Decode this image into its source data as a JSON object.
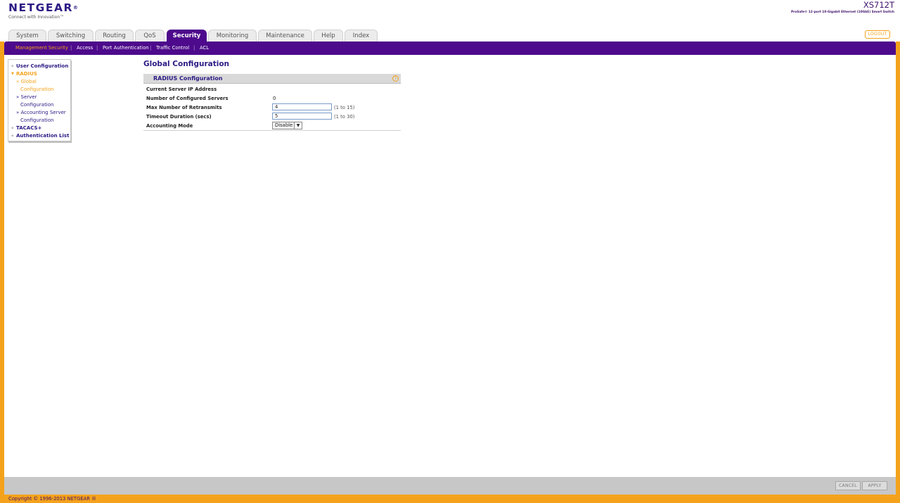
{
  "header": {
    "brand": "NETGEAR",
    "brand_mark": "®",
    "tagline": "Connect with Innovation™",
    "model": "XS712T",
    "model_description": "ProSafe® 12-port 10-Gigabit Ethernet (10GbE) Smart Switch",
    "logout_label": "LOGOUT"
  },
  "tabs": [
    {
      "label": "System"
    },
    {
      "label": "Switching"
    },
    {
      "label": "Routing"
    },
    {
      "label": "QoS"
    },
    {
      "label": "Security",
      "active": true
    },
    {
      "label": "Monitoring"
    },
    {
      "label": "Maintenance"
    },
    {
      "label": "Help"
    },
    {
      "label": "Index"
    }
  ],
  "subnav": [
    {
      "label": "Management Security",
      "active": true
    },
    {
      "label": "Access"
    },
    {
      "label": "Port Authentication"
    },
    {
      "label": "Traffic Control"
    },
    {
      "label": "ACL"
    }
  ],
  "sidebar": {
    "items": [
      {
        "label": "User Configuration"
      },
      {
        "label": "RADIUS",
        "expanded": true
      },
      {
        "label": "» Global"
      },
      {
        "label": "Configuration"
      },
      {
        "label": "» Server"
      },
      {
        "label": "Configuration"
      },
      {
        "label": "» Accounting Server"
      },
      {
        "label": "Configuration"
      },
      {
        "label": "TACACS+"
      },
      {
        "label": "Authentication List"
      }
    ]
  },
  "main": {
    "title": "Global Configuration",
    "panel_title": "RADIUS Configuration",
    "help_glyph": "?",
    "rows": [
      {
        "label": "Current Server IP Address",
        "value": ""
      },
      {
        "label": "Number of Configured Servers",
        "value": "0"
      },
      {
        "label": "Max Number of Retransmits",
        "value": "4",
        "hint": "(1 to 15)"
      },
      {
        "label": "Timeout Duration (secs)",
        "value": "5",
        "hint": "(1 to 30)"
      },
      {
        "label": "Accounting Mode",
        "value": "Disable"
      }
    ]
  },
  "footer": {
    "cancel_label": "CANCEL",
    "apply_label": "APPLY",
    "copyright": "Copyright © 1996-2013 NETGEAR ®"
  },
  "colors": {
    "brand_purple": "#4d0a8c",
    "accent_orange": "#f4a21c",
    "nav_text": "#2d1a84"
  },
  "icons": {
    "help": "help-icon",
    "select_arrow": "chevron-down-icon"
  }
}
